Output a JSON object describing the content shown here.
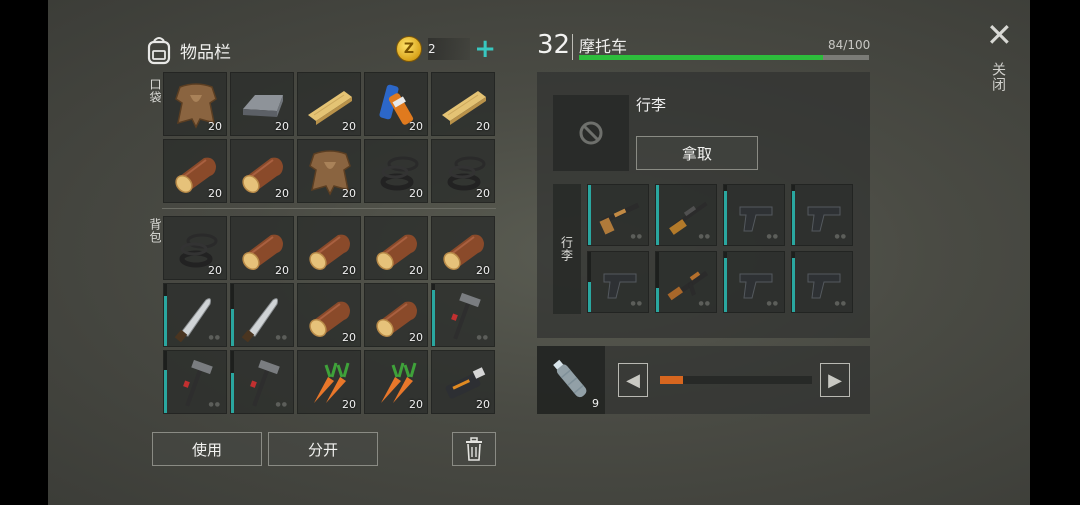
{
  "inventory": {
    "title": "物品栏",
    "coins": "2",
    "pocket_label": "口袋",
    "backpack_label": "背包",
    "use_button": "使用",
    "split_button": "分开",
    "pocket_slots": [
      {
        "item": "animal-skin",
        "count": "20"
      },
      {
        "item": "iron-ingot",
        "count": "20"
      },
      {
        "item": "wood-plank",
        "count": "20"
      },
      {
        "item": "batteries",
        "count": "20"
      },
      {
        "item": "wood-plank",
        "count": "20"
      },
      {
        "item": "log",
        "count": "20"
      },
      {
        "item": "log",
        "count": "20"
      },
      {
        "item": "animal-skin",
        "count": "20"
      },
      {
        "item": "rubber-rings",
        "count": "20"
      },
      {
        "item": "rubber-rings",
        "count": "20"
      }
    ],
    "backpack_slots": [
      {
        "item": "rubber-rings",
        "count": "20"
      },
      {
        "item": "log",
        "count": "20"
      },
      {
        "item": "log",
        "count": "20"
      },
      {
        "item": "log",
        "count": "20"
      },
      {
        "item": "log",
        "count": "20"
      },
      {
        "item": "machete",
        "count": "",
        "durability": 0.8
      },
      {
        "item": "machete",
        "count": "",
        "durability": 0.6
      },
      {
        "item": "log",
        "count": "20"
      },
      {
        "item": "log",
        "count": "20"
      },
      {
        "item": "hammer",
        "count": "",
        "durability": 0.9
      },
      {
        "item": "hammer",
        "count": "",
        "durability": 0.7
      },
      {
        "item": "hammer",
        "count": "",
        "durability": 0.65
      },
      {
        "item": "carrots",
        "count": "20"
      },
      {
        "item": "carrots",
        "count": "20"
      },
      {
        "item": "usb-drive",
        "count": "20"
      }
    ]
  },
  "vehicle": {
    "level": "32",
    "name": "摩托车",
    "hp_text": "84/100",
    "hp_fraction": 0.84,
    "luggage_label": "行李",
    "take_button": "拿取",
    "weapons_label": "行李",
    "weapon_slots": [
      {
        "item": "shotgun",
        "durability": 1.0
      },
      {
        "item": "hunting-rifle",
        "durability": 1.0
      },
      {
        "item": "pistol",
        "durability": 0.9
      },
      {
        "item": "pistol",
        "durability": 0.9
      },
      {
        "item": "pistol",
        "durability": 0.5
      },
      {
        "item": "ak-rifle",
        "durability": 0.4
      },
      {
        "item": "pistol",
        "durability": 0.9
      },
      {
        "item": "pistol",
        "durability": 0.9
      }
    ],
    "fuel_count": "9",
    "fuel_fraction": 0.15
  },
  "close_label": "关闭",
  "colors": {
    "accent": "#2aa7a0",
    "hp": "#2dbd3c",
    "fuel": "#d7661f",
    "coin": "#f2c230"
  }
}
